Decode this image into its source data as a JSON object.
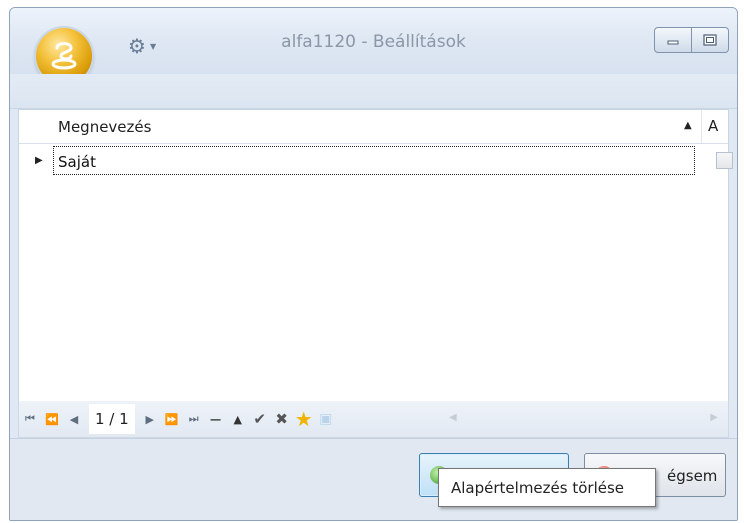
{
  "window": {
    "title": "alfa1120 - Beállítások",
    "app_icon": "app-orb-icon"
  },
  "toolbar": {
    "settings_icon": "gear-icon",
    "dropdown_icon": "chevron-down-icon"
  },
  "grid": {
    "columns": [
      "Megnevezés",
      "A"
    ],
    "sort_indicator": "▲",
    "rows": [
      {
        "name": "Saját",
        "checked": false
      }
    ]
  },
  "navigator": {
    "page": "1 / 1",
    "icons": [
      "first-icon",
      "prev-page-icon",
      "prev-icon",
      "next-icon",
      "next-page-icon",
      "last-icon",
      "delete-icon",
      "up-icon",
      "check-icon",
      "cancel-icon",
      "star-icon",
      "disabled-icon"
    ]
  },
  "footer": {
    "ok_label": "",
    "cancel_label": "égsem"
  },
  "tooltip": {
    "text": "Alapértelmezés törlése"
  }
}
